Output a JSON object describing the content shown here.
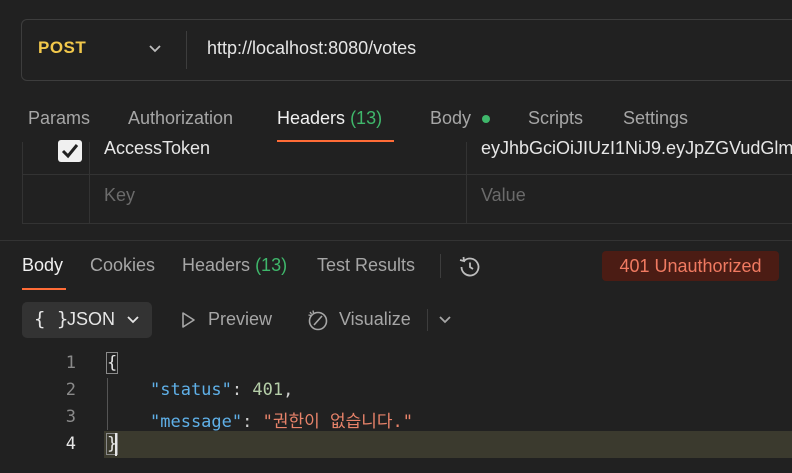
{
  "request": {
    "method": "POST",
    "url": "http://localhost:8080/votes",
    "tabs": {
      "params": "Params",
      "authorization": "Authorization",
      "headers": "Headers",
      "headers_count": "(13)",
      "body": "Body",
      "scripts": "Scripts",
      "settings": "Settings"
    },
    "header_row": {
      "key": "AccessToken",
      "value": "eyJhbGciOiJIUzI1NiJ9.eyJpZGVudGlm"
    },
    "placeholder_row": {
      "key": "Key",
      "value": "Value"
    }
  },
  "response": {
    "tabs": {
      "body": "Body",
      "cookies": "Cookies",
      "headers": "Headers",
      "headers_count": "(13)",
      "test_results": "Test Results"
    },
    "status": "401 Unauthorized",
    "format": {
      "braces": "{ }",
      "label": "JSON",
      "preview": "Preview",
      "visualize": "Visualize"
    },
    "code": {
      "line_numbers": [
        "1",
        "2",
        "3",
        "4"
      ],
      "open_brace": "{",
      "close_brace": "}",
      "status_key": "\"status\"",
      "status_value": "401",
      "message_key": "\"message\"",
      "message_value": "\"권한이 없습니다.\""
    }
  },
  "colors": {
    "accent": "#ff6c37",
    "method": "#f2c84b",
    "count": "#3fb76b",
    "error": "#f07a61"
  },
  "icons": [
    "chevron-down-icon",
    "history-icon",
    "play-icon",
    "visualize-icon",
    "check-icon"
  ]
}
